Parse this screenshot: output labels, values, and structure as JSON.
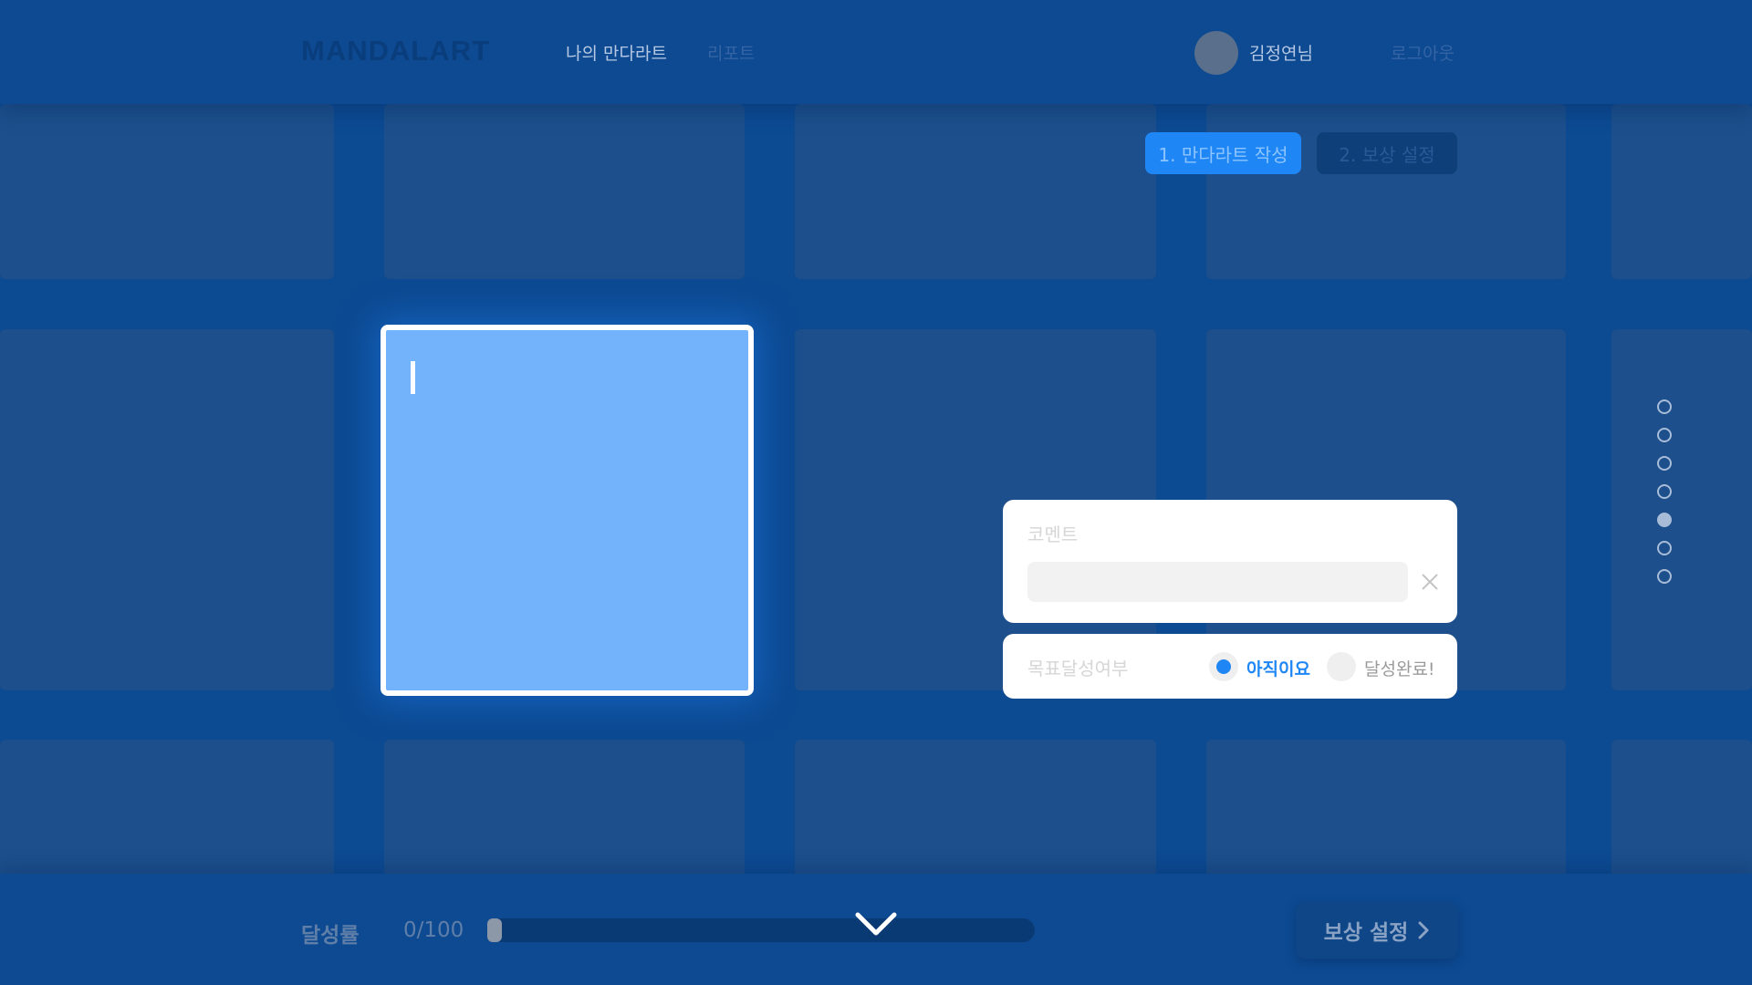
{
  "header": {
    "logo": "MANDALART",
    "nav": [
      {
        "label": "나의 만다라트"
      },
      {
        "label": "리포트"
      }
    ],
    "user_name": "김정연님",
    "logout_label": "로그아웃"
  },
  "steps": [
    {
      "label": "1. 만다라트 작성",
      "active": true
    },
    {
      "label": "2. 보상 설정",
      "active": false
    }
  ],
  "editor": {
    "value": ""
  },
  "comment": {
    "label": "코멘트",
    "value": "",
    "placeholder": ""
  },
  "goal_status": {
    "label": "목표달성여부",
    "options": [
      {
        "label": "아직이요",
        "selected": true
      },
      {
        "label": "달성완료!",
        "selected": false
      }
    ]
  },
  "page_dots": {
    "count": 7,
    "active_index": 4
  },
  "footer": {
    "progress_label": "달성률",
    "progress_count": "0/100",
    "progress_fraction": 0,
    "reward_button_label": "보상 설정"
  },
  "colors": {
    "background": "#0c4a92",
    "accent": "#1f87f5",
    "selected_cell": "#72b3fb"
  }
}
